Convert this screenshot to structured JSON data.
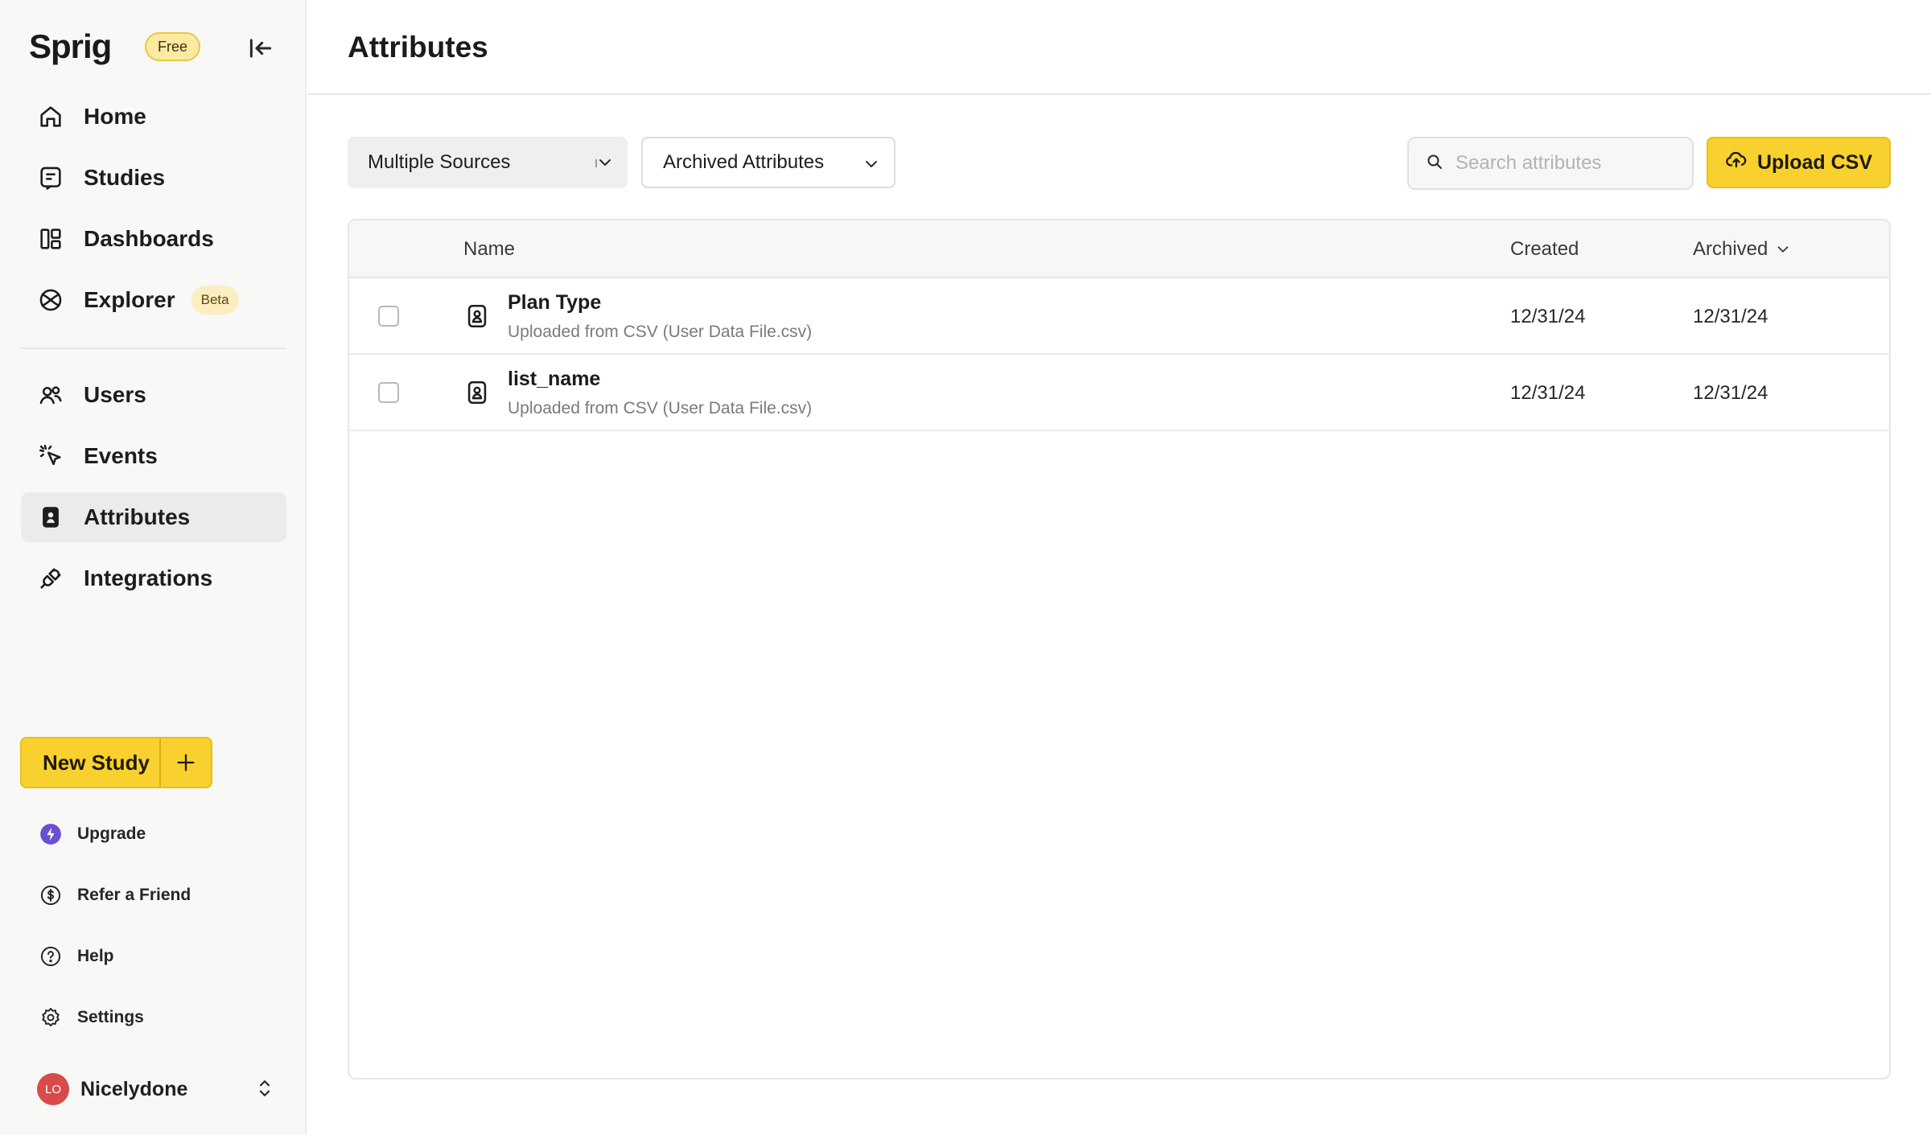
{
  "brand": {
    "logo": "Sprig",
    "plan_badge": "Free"
  },
  "nav_primary": [
    {
      "label": "Home",
      "icon": "home-icon"
    },
    {
      "label": "Studies",
      "icon": "studies-icon"
    },
    {
      "label": "Dashboards",
      "icon": "dashboards-icon"
    },
    {
      "label": "Explorer",
      "icon": "explorer-icon",
      "badge": "Beta"
    }
  ],
  "nav_secondary": [
    {
      "label": "Users",
      "icon": "users-icon"
    },
    {
      "label": "Events",
      "icon": "events-icon"
    },
    {
      "label": "Attributes",
      "icon": "attributes-icon",
      "active": true
    },
    {
      "label": "Integrations",
      "icon": "integrations-icon"
    }
  ],
  "new_study": {
    "label": "New Study"
  },
  "utility": [
    {
      "label": "Upgrade",
      "icon": "upgrade-icon"
    },
    {
      "label": "Refer a Friend",
      "icon": "dollar-icon"
    },
    {
      "label": "Help",
      "icon": "help-icon"
    },
    {
      "label": "Settings",
      "icon": "settings-icon"
    }
  ],
  "profile": {
    "initials": "LO",
    "name": "Nicelydone"
  },
  "page": {
    "title": "Attributes"
  },
  "filters": {
    "source": "Multiple Sources",
    "status": "Archived Attributes"
  },
  "search": {
    "placeholder": "Search attributes"
  },
  "upload": {
    "label": "Upload CSV"
  },
  "table": {
    "columns": {
      "name": "Name",
      "created": "Created",
      "archived": "Archived"
    },
    "rows": [
      {
        "name": "Plan Type",
        "source": "Uploaded from CSV (User Data File.csv)",
        "created": "12/31/24",
        "archived": "12/31/24"
      },
      {
        "name": "list_name",
        "source": "Uploaded from CSV (User Data File.csv)",
        "created": "12/31/24",
        "archived": "12/31/24"
      }
    ]
  },
  "colors": {
    "accent": "#f8d12f",
    "sidebar_bg": "#f8f8f7",
    "upgrade": "#6b4fd1",
    "avatar": "#d94a4a"
  }
}
